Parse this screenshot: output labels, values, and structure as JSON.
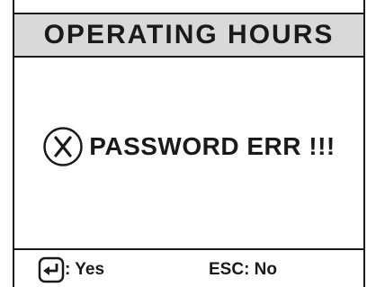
{
  "header": {
    "title": "OPERATING HOURS"
  },
  "message": {
    "icon": "error-x-circle-icon",
    "text": "PASSWORD ERR !!!"
  },
  "footer": {
    "confirm": {
      "icon": "enter-key-icon",
      "label": ": Yes"
    },
    "cancel": {
      "label": "ESC: No"
    }
  },
  "colors": {
    "header_bg": "#d9d9d9",
    "foreground": "#1a1a1a",
    "background": "#ffffff"
  }
}
